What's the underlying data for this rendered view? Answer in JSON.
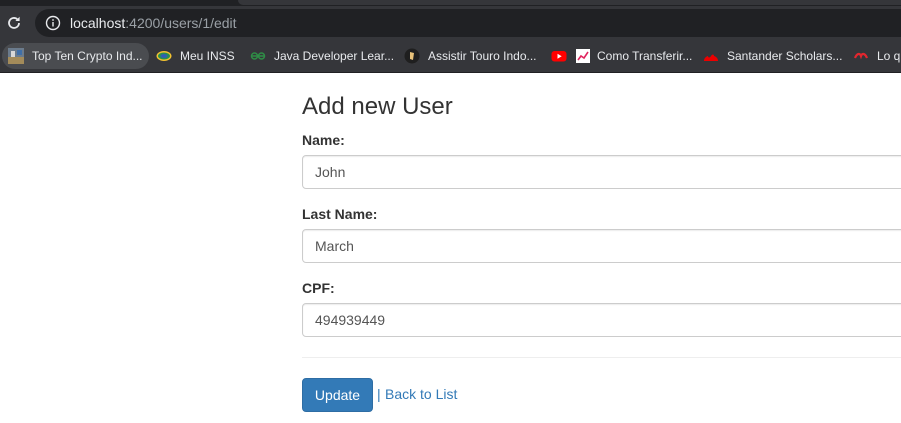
{
  "browser": {
    "url_host": "localhost",
    "url_path": ":4200/users/1/edit",
    "bookmarks": [
      {
        "label": "Top Ten Crypto Ind...",
        "icon": "crypto-thumbnail-icon"
      },
      {
        "label": "Meu INSS",
        "icon": "inss-icon"
      },
      {
        "label": "Java Developer Lear...",
        "icon": "geeksforgeeks-icon"
      },
      {
        "label": "Assistir Touro Indo...",
        "icon": "touro-icon"
      },
      {
        "label": "Como Transferir...",
        "icon": "youtube-icon"
      },
      {
        "label": "Santander Scholars...",
        "icon": "santander-icon"
      },
      {
        "label": "Lo q",
        "icon": "lo-q-icon"
      }
    ]
  },
  "form": {
    "title": "Add new User",
    "name_label": "Name:",
    "name_value": "John",
    "lastname_label": "Last Name:",
    "lastname_value": "March",
    "cpf_label": "CPF:",
    "cpf_value": "494939449",
    "update_label": "Update",
    "separator": "|",
    "back_label": "Back to List"
  },
  "colors": {
    "primary_button": "#337ab7",
    "link": "#337ab7",
    "browser_toolbar": "#35363a",
    "omnibox": "#202124"
  }
}
